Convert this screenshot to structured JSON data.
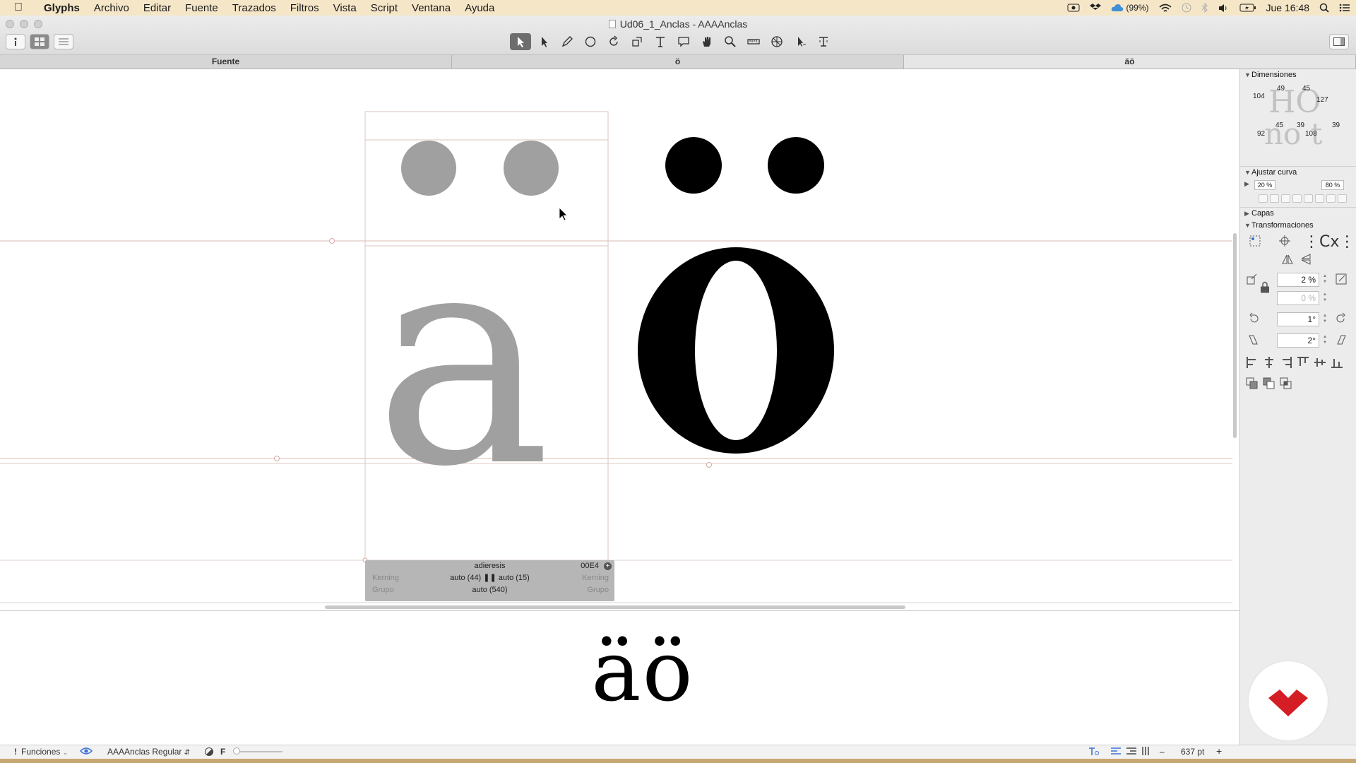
{
  "menubar": {
    "app": "Glyphs",
    "items": [
      "Archivo",
      "Editar",
      "Fuente",
      "Trazados",
      "Filtros",
      "Vista",
      "Script",
      "Ventana",
      "Ayuda"
    ],
    "battery_cloud": "(99%)",
    "clock": "Jue 16:48"
  },
  "window": {
    "title": "Ud06_1_Anclas - AAAAnclas"
  },
  "tabs": [
    "Fuente",
    "ö",
    "äö"
  ],
  "editor": {
    "background_glyph": "a",
    "foreground_glyph": "ö",
    "glyph_name": "adieresis",
    "unicode": "00E4",
    "kerning_label": "Kerning",
    "kerning_left": "auto (44)",
    "kerning_right": "auto (15)",
    "group_label": "Grupo",
    "group_value": "auto (540)"
  },
  "preview": {
    "text": "äö"
  },
  "panel": {
    "dimensions_title": "Dimensiones",
    "dim_numbers": {
      "h_left": "104",
      "h_top": "49",
      "o_top": "45",
      "o_right": "127",
      "n_left": "92",
      "n_top": "45",
      "o2_top": "39",
      "o2_right": "108",
      "t_top": "39"
    },
    "dim_ghost_upper": "HO",
    "dim_ghost_lower": "no t",
    "curve_title": "Ajustar curva",
    "curve_min": "20 %",
    "curve_max": "80 %",
    "layers_title": "Capas",
    "transform_title": "Transformaciones",
    "scale_x": "2 %",
    "scale_y": "0 %",
    "rotate": "1°",
    "slant": "2°"
  },
  "bottombar": {
    "features": "Funciones",
    "master": "AAAAnclas Regular",
    "f_label": "F",
    "size": "637 pt"
  },
  "colors": {
    "menubar": "#f5e6c8",
    "guide": "#d8b8b0",
    "background_glyph": "#a0a0a0",
    "logo_red": "#d41d24"
  }
}
